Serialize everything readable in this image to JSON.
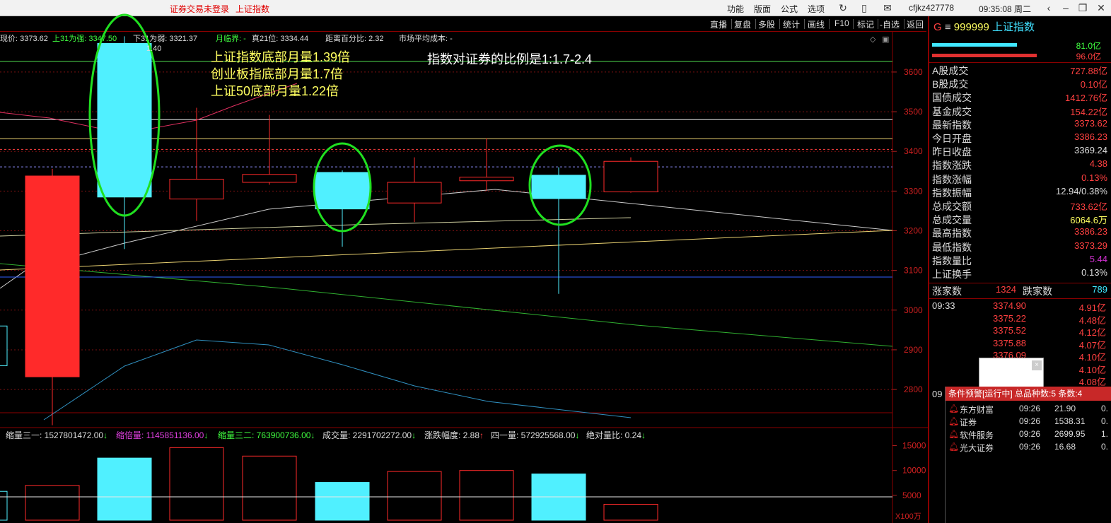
{
  "titlebar": {
    "status": "证券交易未登录",
    "index_name": "上证指数",
    "menus": [
      "功能",
      "版面",
      "公式",
      "选项"
    ],
    "user": "cfjkz427778",
    "time": "09:35:08 周二"
  },
  "toolbar": {
    "buttons": [
      "直播",
      "复盘",
      "多股",
      "统计",
      "画线",
      "F10",
      "标记",
      "-自选",
      "返回"
    ]
  },
  "infobar": {
    "price": "现价: 3373.62",
    "up": "上31为强: 3347.50",
    "down": "下31为弱: 3321.37",
    "month": "月临界: -",
    "real21": "真21位: 3334.44",
    "distance": "距离百分比: 2.32",
    "cost": "市场平均成本: -"
  },
  "annotations": {
    "line1": "上证指数底部月量1.39倍",
    "line2": "创业板指底部月量1.7倍",
    "line3": "上证50底部月量1.22倍",
    "ratio": "指数对证券的比例是1:1.7-2.4",
    "tiny": "1.40"
  },
  "price_axis": {
    "ticks": [
      "3600",
      "3500",
      "3400",
      "3300",
      "3200",
      "3100",
      "3000",
      "2900",
      "2800"
    ]
  },
  "volume_bar": {
    "i1": "缩量三一: 1527801472.00",
    "i2": "缩倍量: 1145851136.00",
    "i3": "缩量三二: 763900736.00",
    "i4": "成交量: 2291702272.00",
    "i5": "涨跌幅度: 2.88",
    "i6": "四一量: 572925568.00",
    "i7": "绝对量比: 0.24",
    "ticks": [
      "15000",
      "10000",
      "5000"
    ],
    "unit": "X100万"
  },
  "right_panel": {
    "header_code": "999999",
    "header_name": "上证指数",
    "header_prefix": "G",
    "bar1_value": "81.0亿",
    "bar2_value": "96.0亿",
    "rows": [
      {
        "label": "A股成交",
        "value": "727.88亿",
        "color": "#ff4040"
      },
      {
        "label": "B股成交",
        "value": "0.10亿",
        "color": "#ff4040"
      },
      {
        "label": "国债成交",
        "value": "1412.76亿",
        "color": "#ff4040"
      },
      {
        "label": "基金成交",
        "value": "154.22亿",
        "color": "#ff4040"
      },
      {
        "label": "最新指数",
        "value": "3373.62",
        "color": "#ff4040"
      },
      {
        "label": "今日开盘",
        "value": "3386.23",
        "color": "#ff4040"
      },
      {
        "label": "昨日收盘",
        "value": "3369.24",
        "color": "#dddddd"
      },
      {
        "label": "指数涨跌",
        "value": "4.38",
        "color": "#ff4040"
      },
      {
        "label": "指数涨幅",
        "value": "0.13%",
        "color": "#ff4040"
      },
      {
        "label": "指数振幅",
        "value": "12.94/0.38%",
        "color": "#dddddd"
      },
      {
        "label": "总成交额",
        "value": "733.62亿",
        "color": "#ff4040"
      },
      {
        "label": "总成交量",
        "value": "6064.6万",
        "color": "#ffff60"
      },
      {
        "label": "最高指数",
        "value": "3386.23",
        "color": "#ff4040"
      },
      {
        "label": "最低指数",
        "value": "3373.29",
        "color": "#ff4040"
      },
      {
        "label": "指数量比",
        "value": "5.44",
        "color": "#d030d0"
      },
      {
        "label": "上证换手",
        "value": "0.13%",
        "color": "#dddddd"
      }
    ],
    "up_label": "涨家数",
    "up_count": "1324",
    "down_label": "跌家数",
    "down_count": "789",
    "tick_time": "09:33",
    "ticks": [
      {
        "price": "3374.90",
        "amount": "4.91亿"
      },
      {
        "price": "3375.22",
        "amount": "4.48亿"
      },
      {
        "price": "3375.52",
        "amount": "4.12亿"
      },
      {
        "price": "3375.88",
        "amount": "4.07亿"
      },
      {
        "price": "3376.09",
        "amount": "4.10亿"
      },
      {
        "price": "",
        "amount": "4.10亿"
      },
      {
        "price": "",
        "amount": "4.08亿"
      }
    ],
    "lower_time": "09"
  },
  "alert": {
    "header": "条件预警[运行中] 总品种数:5 条数:4",
    "rows": [
      {
        "name": "东方财富",
        "time": "09:26",
        "price": "21.90",
        "extra": "0."
      },
      {
        "name": "证券",
        "time": "09:26",
        "price": "1538.31",
        "extra": "0."
      },
      {
        "name": "软件服务",
        "time": "09:26",
        "price": "2699.95",
        "extra": "1."
      },
      {
        "name": "光大证券",
        "time": "09:26",
        "price": "16.68",
        "extra": "0."
      }
    ]
  },
  "chart_data": {
    "type": "candlestick",
    "title": "上证指数",
    "ylim": [
      2720,
      3680
    ],
    "candles": [
      {
        "open": 2960,
        "close": 2860,
        "high": 2960,
        "low": 2860,
        "color": "cyan",
        "partial": true
      },
      {
        "open": 3338,
        "close": 2832,
        "high": 3356,
        "low": 2710,
        "color": "red",
        "filled": true
      },
      {
        "open": 3285,
        "close": 3672,
        "high": 3690,
        "low": 3154,
        "color": "cyan",
        "filled": true
      },
      {
        "open": 3280,
        "close": 3330,
        "high": 3510,
        "low": 3225,
        "color": "red",
        "filled": false
      },
      {
        "open": 3322,
        "close": 3342,
        "high": 3492,
        "low": 3316,
        "color": "red",
        "filled": false
      },
      {
        "open": 3347,
        "close": 3255,
        "high": 3352,
        "low": 3160,
        "color": "cyan",
        "filled": true
      },
      {
        "open": 3270,
        "close": 3322,
        "high": 3385,
        "low": 3222,
        "color": "red",
        "filled": false
      },
      {
        "open": 3326,
        "close": 3335,
        "high": 3433,
        "low": 3300,
        "color": "red",
        "filled": false
      },
      {
        "open": 3340,
        "close": 3281,
        "high": 3360,
        "low": 3041,
        "color": "cyan",
        "filled": true
      },
      {
        "open": 3298,
        "close": 3375,
        "high": 3385,
        "low": 3296,
        "color": "red",
        "filled": false
      }
    ],
    "volumes": [
      5800,
      7000,
      12500,
      14600,
      12900,
      7600,
      9800,
      10000,
      9300,
      3200
    ]
  }
}
